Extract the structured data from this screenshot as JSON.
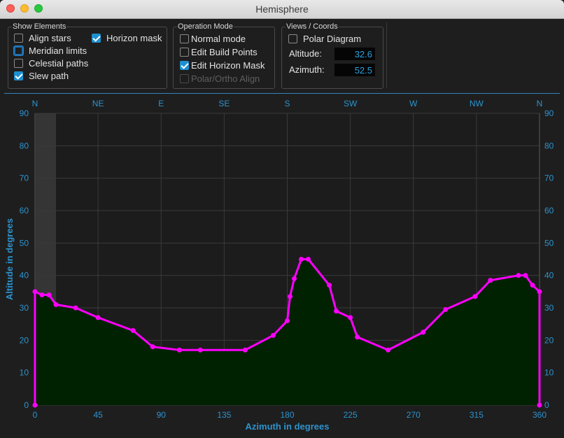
{
  "window": {
    "title": "Hemisphere"
  },
  "show_elements": {
    "title": "Show Elements",
    "items": [
      {
        "label": "Align stars",
        "checked": false
      },
      {
        "label": "Horizon mask",
        "checked": true
      },
      {
        "label": "Meridian limits",
        "checked": false
      },
      {
        "label": "Celestial paths",
        "checked": false
      },
      {
        "label": "Slew path",
        "checked": true
      }
    ]
  },
  "operation_mode": {
    "title": "Operation Mode",
    "items": [
      {
        "label": "Normal mode",
        "checked": false
      },
      {
        "label": "Edit Build Points",
        "checked": false
      },
      {
        "label": "Edit Horizon Mask",
        "checked": true
      },
      {
        "label": "Polar/Ortho Align",
        "checked": false,
        "disabled": true
      }
    ]
  },
  "views_coords": {
    "title": "Views / Coords",
    "polar_label": "Polar Diagram",
    "polar_checked": false,
    "altitude_label": "Altitude:",
    "altitude_value": "32.6",
    "azimuth_label": "Azimuth:",
    "azimuth_value": "52.5"
  },
  "colors": {
    "axis": "#2c93cf",
    "grid": "#3a3a3a",
    "mask_fill": "#002200",
    "mask_line": "#ff00ff",
    "meridian_band": "#3a3a3a"
  },
  "chart_data": {
    "type": "area",
    "xlabel": "Azimuth in degrees",
    "ylabel": "Altitude in degrees",
    "xlim": [
      0,
      360
    ],
    "ylim": [
      0,
      90
    ],
    "x_ticks": [
      "0",
      "45",
      "90",
      "135",
      "180",
      "225",
      "270",
      "315",
      "360"
    ],
    "y_ticks": [
      "0",
      "10",
      "20",
      "30",
      "40",
      "50",
      "60",
      "70",
      "80",
      "90"
    ],
    "compass_labels": [
      "N",
      "NE",
      "E",
      "SE",
      "S",
      "SW",
      "W",
      "NW",
      "N"
    ],
    "grid": true,
    "shaded_band": {
      "x_from": 0,
      "x_to": 15,
      "y_from": 30,
      "y_to": 90
    },
    "series": [
      {
        "x": [
          0,
          0,
          5,
          10,
          15,
          29,
          45,
          70,
          84,
          103,
          118,
          150,
          170,
          180,
          182,
          185,
          190,
          195,
          210,
          215,
          225,
          230,
          252,
          277,
          293,
          314,
          325,
          345,
          350,
          355,
          360,
          360
        ],
        "y": [
          0,
          35,
          34,
          34,
          31,
          30,
          27,
          23,
          18,
          17,
          17,
          17,
          21.5,
          26,
          33.5,
          39,
          45,
          45,
          37,
          29,
          27,
          21,
          17,
          22.5,
          29.5,
          33.5,
          38.5,
          40,
          40,
          37,
          35,
          0
        ]
      }
    ]
  }
}
